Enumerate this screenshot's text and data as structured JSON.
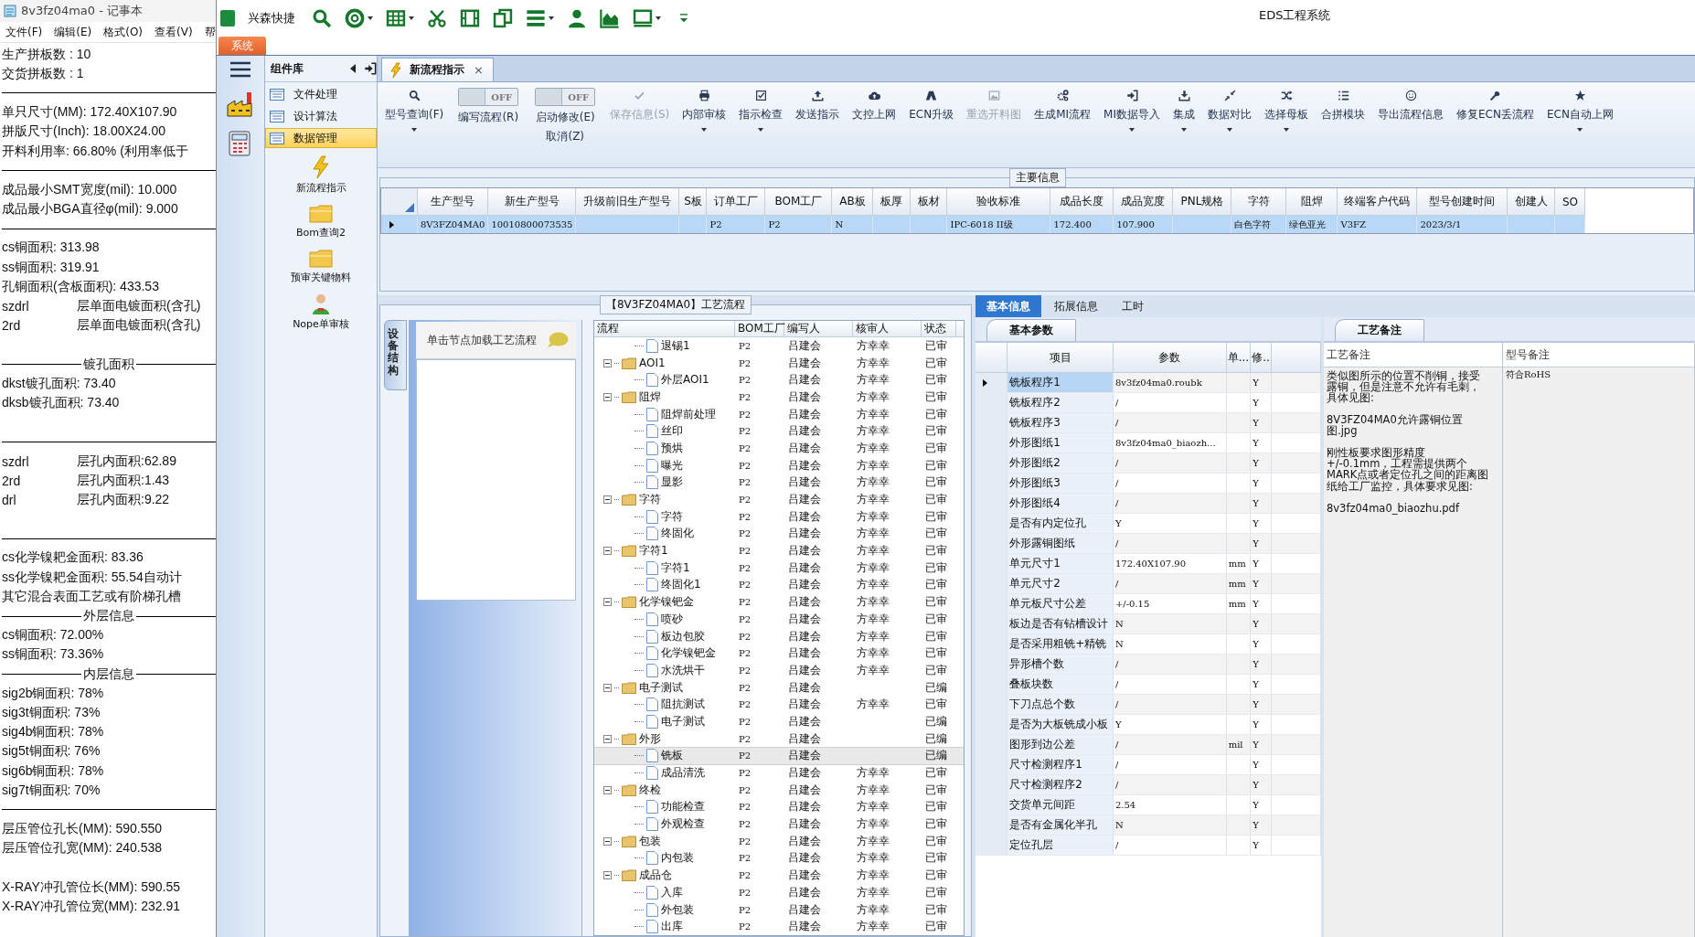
{
  "notepad": {
    "title": "8v3fz04ma0 - 记事本",
    "menu": [
      "文件(F)",
      "编辑(E)",
      "格式(O)",
      "查看(V)",
      "帮"
    ],
    "lines": [
      {
        "kind": "text",
        "text": "生产拼板数 : 10"
      },
      {
        "kind": "text",
        "text": "交货拼板数 : 1"
      },
      {
        "kind": "rule"
      },
      {
        "kind": "text",
        "text": "单只尺寸(MM): 172.40X107.90"
      },
      {
        "kind": "text",
        "text": "拼版尺寸(Inch): 18.00X24.00"
      },
      {
        "kind": "text",
        "text": "开料利用率: 66.80% (利用率低于"
      },
      {
        "kind": "rule"
      },
      {
        "kind": "text",
        "text": "成品最小SMT宽度(mil): 10.000"
      },
      {
        "kind": "text",
        "text": "成品最小BGA直径φ(mil):  9.000"
      },
      {
        "kind": "rule"
      },
      {
        "kind": "text",
        "text": "cs铜面积: 313.98"
      },
      {
        "kind": "text",
        "text": "ss铜面积: 319.91"
      },
      {
        "kind": "text",
        "text": "孔铜面积(含板面积): 433.53"
      },
      {
        "kind": "pair",
        "a": "szdrl",
        "b": "层单面电镀面积(含孔)"
      },
      {
        "kind": "pair",
        "a": "2rd",
        "b": "层单面电镀面积(含孔)"
      },
      {
        "kind": "blank"
      },
      {
        "kind": "heading",
        "text": "镀孔面积"
      },
      {
        "kind": "text",
        "text": "dkst镀孔面积: 73.40"
      },
      {
        "kind": "text",
        "text": "dksb镀孔面积: 73.40"
      },
      {
        "kind": "blank"
      },
      {
        "kind": "rule"
      },
      {
        "kind": "pair",
        "a": "szdrl",
        "b": "层孔内面积:62.89"
      },
      {
        "kind": "pair",
        "a": "2rd",
        "b": "层孔内面积:1.43"
      },
      {
        "kind": "pair",
        "a": "drl",
        "b": "层孔内面积:9.22"
      },
      {
        "kind": "blank"
      },
      {
        "kind": "rule"
      },
      {
        "kind": "text",
        "text": "cs化学镍耙金面积: 83.36"
      },
      {
        "kind": "text",
        "text": "ss化学镍耙金面积: 55.54自动计"
      },
      {
        "kind": "text",
        "text": "其它混合表面工艺或有阶梯孔槽"
      },
      {
        "kind": "heading",
        "text": "外层信息"
      },
      {
        "kind": "text",
        "text": "cs铜面积: 72.00%"
      },
      {
        "kind": "text",
        "text": "ss铜面积: 73.36%"
      },
      {
        "kind": "heading",
        "text": "内层信息"
      },
      {
        "kind": "text",
        "text": "sig2b铜面积: 78%"
      },
      {
        "kind": "text",
        "text": "sig3t铜面积: 73%"
      },
      {
        "kind": "text",
        "text": "sig4b铜面积: 78%"
      },
      {
        "kind": "text",
        "text": "sig5t铜面积: 76%"
      },
      {
        "kind": "text",
        "text": "sig6b铜面积: 78%"
      },
      {
        "kind": "text",
        "text": "sig7t铜面积: 70%"
      },
      {
        "kind": "rule"
      },
      {
        "kind": "text",
        "text": "层压管位孔长(MM): 590.550"
      },
      {
        "kind": "text",
        "text": "层压管位孔宽(MM): 240.538"
      },
      {
        "kind": "blank"
      },
      {
        "kind": "text",
        "text": "X-RAY冲孔管位长(MM): 590.55"
      },
      {
        "kind": "text",
        "text": "X-RAY冲孔管位宽(MM): 232.91"
      }
    ]
  },
  "app": {
    "title": "EDS工程系统",
    "quick_label": "兴森快捷",
    "quick_tools": [
      {
        "dropdown": false
      },
      {
        "dropdown": true
      },
      {
        "dropdown": true
      },
      {
        "dropdown": false
      },
      {
        "dropdown": false
      },
      {
        "dropdown": false
      },
      {
        "dropdown": true
      },
      {
        "dropdown": false
      },
      {
        "dropdown": false
      },
      {
        "dropdown": true
      },
      {
        "dropdown": false
      }
    ],
    "system_tab": "系统"
  },
  "component_panel": {
    "title": "组件库",
    "categories": [
      {
        "label": "文件处理",
        "selected": false
      },
      {
        "label": "设计算法",
        "selected": false
      },
      {
        "label": "数据管理",
        "selected": true
      }
    ],
    "tools": [
      {
        "label": "新流程指示"
      },
      {
        "label": "Bom查询2"
      },
      {
        "label": "预审关键物料"
      },
      {
        "label": "Nope单审核"
      }
    ]
  },
  "doc_tab": {
    "label": "新流程指示",
    "close": "×"
  },
  "ribbon": [
    {
      "kind": "button",
      "label": "型号查询(F)",
      "dropdown": true,
      "disabled": false
    },
    {
      "kind": "toggle",
      "label": "编写流程(R)",
      "state_text": "OFF",
      "on": false
    },
    {
      "kind": "toggle",
      "label": "启动修改(E)",
      "label_2": "取消(Z)",
      "state_text": "OFF",
      "on": false
    },
    {
      "kind": "button",
      "label": "保存信息(S)",
      "dropdown": false,
      "disabled": true
    },
    {
      "kind": "button",
      "label": "内部审核",
      "dropdown": true,
      "disabled": false
    },
    {
      "kind": "button",
      "label": "指示检查",
      "dropdown": true,
      "disabled": false
    },
    {
      "kind": "button",
      "label": "发送指示",
      "dropdown": false,
      "disabled": false
    },
    {
      "kind": "button",
      "label": "文控上网",
      "dropdown": false,
      "disabled": false
    },
    {
      "kind": "button",
      "label": "ECN升级",
      "dropdown": false,
      "disabled": false
    },
    {
      "kind": "button",
      "label": "重选开料图",
      "dropdown": false,
      "disabled": true
    },
    {
      "kind": "button",
      "label": "生成MI流程",
      "dropdown": false,
      "disabled": false
    },
    {
      "kind": "button",
      "label": "MI数据导入",
      "dropdown": true,
      "disabled": false
    },
    {
      "kind": "button",
      "label": "集成",
      "dropdown": true,
      "disabled": false
    },
    {
      "kind": "button",
      "label": "数据对比",
      "dropdown": true,
      "disabled": false
    },
    {
      "kind": "button",
      "label": "选择母板",
      "dropdown": true,
      "disabled": false
    },
    {
      "kind": "button",
      "label": "合拼模块",
      "dropdown": false,
      "disabled": false
    },
    {
      "kind": "button",
      "label": "导出流程信息",
      "dropdown": false,
      "disabled": false
    },
    {
      "kind": "button",
      "label": "修复ECN丢流程",
      "dropdown": false,
      "disabled": false
    },
    {
      "kind": "button",
      "label": "ECN自动上网",
      "dropdown": true,
      "disabled": false
    }
  ],
  "main_info": {
    "title": "主要信息",
    "columns": [
      "生产型号",
      "新生产型号",
      "升级前旧生产型号",
      "S板",
      "订单工厂",
      "BOM工厂",
      "AB板",
      "板厚",
      "板材",
      "验收标准",
      "成品长度",
      "成品宽度",
      "PNL规格",
      "字符",
      "阻焊",
      "终端客户代码",
      "型号创建时间",
      "创建人",
      "SO"
    ],
    "rows": [
      {
        "selected": true,
        "cells": [
          "8V3FZ04MA0",
          "10010800073535",
          null,
          null,
          "P2",
          "P2",
          "N",
          null,
          null,
          "IPC-6018 II级",
          "172.400",
          "107.900",
          null,
          "白色字符",
          "绿色亚光",
          "V3FZ",
          "2023/3/1",
          null,
          null
        ]
      }
    ]
  },
  "process": {
    "title": "【8V3FZ04MA0】工艺流程",
    "side_tab": "设备结构",
    "hint": "单击节点加载工艺流程",
    "columns": [
      "流程",
      "BOM工厂",
      "编写人",
      "核审人",
      "状态"
    ],
    "tree": [
      {
        "kind": "doc",
        "name": "退锡1",
        "bom": "P2",
        "writer": "吕建会",
        "reviewer": "方幸幸",
        "status": "已审",
        "selected": false
      },
      {
        "kind": "folder",
        "name": "AOI1",
        "bom": "P2",
        "writer": "吕建会",
        "reviewer": "方幸幸",
        "status": "已审",
        "selected": false,
        "expanded": true,
        "children": [
          {
            "kind": "doc",
            "name": "外层AOI1",
            "bom": "P2",
            "writer": "吕建会",
            "reviewer": "方幸幸",
            "status": "已审",
            "selected": false
          }
        ]
      },
      {
        "kind": "folder",
        "name": "阻焊",
        "bom": "P2",
        "writer": "吕建会",
        "reviewer": "方幸幸",
        "status": "已审",
        "selected": false,
        "expanded": true,
        "children": [
          {
            "kind": "doc",
            "name": "阻焊前处理",
            "bom": "P2",
            "writer": "吕建会",
            "reviewer": "方幸幸",
            "status": "已审",
            "selected": false
          },
          {
            "kind": "doc",
            "name": "丝印",
            "bom": "P2",
            "writer": "吕建会",
            "reviewer": "方幸幸",
            "status": "已审",
            "selected": false
          },
          {
            "kind": "doc",
            "name": "预烘",
            "bom": "P2",
            "writer": "吕建会",
            "reviewer": "方幸幸",
            "status": "已审",
            "selected": false
          },
          {
            "kind": "doc",
            "name": "曝光",
            "bom": "P2",
            "writer": "吕建会",
            "reviewer": "方幸幸",
            "status": "已审",
            "selected": false
          },
          {
            "kind": "doc",
            "name": "显影",
            "bom": "P2",
            "writer": "吕建会",
            "reviewer": "方幸幸",
            "status": "已审",
            "selected": false
          }
        ]
      },
      {
        "kind": "folder",
        "name": "字符",
        "bom": "P2",
        "writer": "吕建会",
        "reviewer": "方幸幸",
        "status": "已审",
        "selected": false,
        "expanded": true,
        "children": [
          {
            "kind": "doc",
            "name": "字符",
            "bom": "P2",
            "writer": "吕建会",
            "reviewer": "方幸幸",
            "status": "已审",
            "selected": false
          },
          {
            "kind": "doc",
            "name": "终固化",
            "bom": "P2",
            "writer": "吕建会",
            "reviewer": "方幸幸",
            "status": "已审",
            "selected": false
          }
        ]
      },
      {
        "kind": "folder",
        "name": "字符1",
        "bom": "P2",
        "writer": "吕建会",
        "reviewer": "方幸幸",
        "status": "已审",
        "selected": false,
        "expanded": true,
        "children": [
          {
            "kind": "doc",
            "name": "字符1",
            "bom": "P2",
            "writer": "吕建会",
            "reviewer": "方幸幸",
            "status": "已审",
            "selected": false
          },
          {
            "kind": "doc",
            "name": "终固化1",
            "bom": "P2",
            "writer": "吕建会",
            "reviewer": "方幸幸",
            "status": "已审",
            "selected": false
          }
        ]
      },
      {
        "kind": "folder",
        "name": "化学镍钯金",
        "bom": "P2",
        "writer": "吕建会",
        "reviewer": "方幸幸",
        "status": "已审",
        "selected": false,
        "expanded": true,
        "children": [
          {
            "kind": "doc",
            "name": "喷砂",
            "bom": "P2",
            "writer": "吕建会",
            "reviewer": "方幸幸",
            "status": "已审",
            "selected": false
          },
          {
            "kind": "doc",
            "name": "板边包胶",
            "bom": "P2",
            "writer": "吕建会",
            "reviewer": "方幸幸",
            "status": "已审",
            "selected": false
          },
          {
            "kind": "doc",
            "name": "化学镍钯金",
            "bom": "P2",
            "writer": "吕建会",
            "reviewer": "方幸幸",
            "status": "已审",
            "selected": false
          },
          {
            "kind": "doc",
            "name": "水洗烘干",
            "bom": "P2",
            "writer": "吕建会",
            "reviewer": "方幸幸",
            "status": "已审",
            "selected": false
          }
        ]
      },
      {
        "kind": "folder",
        "name": "电子测试",
        "bom": "P2",
        "writer": "吕建会",
        "status": "已编",
        "selected": false,
        "expanded": true,
        "children": [
          {
            "kind": "doc",
            "name": "阻抗测试",
            "bom": "P2",
            "writer": "吕建会",
            "reviewer": "方幸幸",
            "status": "已审",
            "selected": false
          },
          {
            "kind": "doc",
            "name": "电子测试",
            "bom": "P2",
            "writer": "吕建会",
            "status": "已编",
            "selected": false
          }
        ]
      },
      {
        "kind": "folder",
        "name": "外形",
        "bom": "P2",
        "writer": "吕建会",
        "status": "已编",
        "selected": false,
        "expanded": true,
        "children": [
          {
            "kind": "doc",
            "name": "铣板",
            "bom": "P2",
            "writer": "吕建会",
            "status": "已编",
            "selected": true
          },
          {
            "kind": "doc",
            "name": "成品清洗",
            "bom": "P2",
            "writer": "吕建会",
            "reviewer": "方幸幸",
            "status": "已审",
            "selected": false
          }
        ]
      },
      {
        "kind": "folder",
        "name": "终检",
        "bom": "P2",
        "writer": "吕建会",
        "reviewer": "方幸幸",
        "status": "已审",
        "selected": false,
        "expanded": true,
        "children": [
          {
            "kind": "doc",
            "name": "功能检查",
            "bom": "P2",
            "writer": "吕建会",
            "reviewer": "方幸幸",
            "status": "已审",
            "selected": false
          },
          {
            "kind": "doc",
            "name": "外观检查",
            "bom": "P2",
            "writer": "吕建会",
            "reviewer": "方幸幸",
            "status": "已审",
            "selected": false
          }
        ]
      },
      {
        "kind": "folder",
        "name": "包装",
        "bom": "P2",
        "writer": "吕建会",
        "reviewer": "方幸幸",
        "status": "已审",
        "selected": false,
        "expanded": true,
        "children": [
          {
            "kind": "doc",
            "name": "内包装",
            "bom": "P2",
            "writer": "吕建会",
            "reviewer": "方幸幸",
            "status": "已审",
            "selected": false
          }
        ]
      },
      {
        "kind": "folder",
        "name": "成品仓",
        "bom": "P2",
        "writer": "吕建会",
        "reviewer": "方幸幸",
        "status": "已审",
        "selected": false,
        "expanded": true,
        "children": [
          {
            "kind": "doc",
            "name": "入库",
            "bom": "P2",
            "writer": "吕建会",
            "reviewer": "方幸幸",
            "status": "已审",
            "selected": false
          },
          {
            "kind": "doc",
            "name": "外包装",
            "bom": "P2",
            "writer": "吕建会",
            "reviewer": "方幸幸",
            "status": "已审",
            "selected": false
          },
          {
            "kind": "doc",
            "name": "出库",
            "bom": "P2",
            "writer": "吕建会",
            "reviewer": "方幸幸",
            "status": "已审",
            "selected": false
          }
        ]
      }
    ]
  },
  "detail_tabs": [
    {
      "label": "基本信息",
      "selected": true
    },
    {
      "label": "拓展信息",
      "selected": false
    },
    {
      "label": "工时",
      "selected": false
    }
  ],
  "params": {
    "title": "基本参数",
    "columns": [
      "项目",
      "参数",
      "单...",
      "修.."
    ],
    "rows": [
      {
        "item": "铣板程序1",
        "value": "8v3fz04ma0.roubk",
        "flag": "Y",
        "selected": true
      },
      {
        "item": "铣板程序2",
        "value": "/",
        "flag": "Y",
        "selected": false
      },
      {
        "item": "铣板程序3",
        "value": "/",
        "flag": "Y",
        "selected": false
      },
      {
        "item": "外形图纸1",
        "value": "8v3fz04ma0_biaozh...",
        "flag": "Y",
        "selected": false
      },
      {
        "item": "外形图纸2",
        "value": "/",
        "flag": "Y",
        "selected": false
      },
      {
        "item": "外形图纸3",
        "value": "/",
        "flag": "Y",
        "selected": false
      },
      {
        "item": "外形图纸4",
        "value": "/",
        "flag": "Y",
        "selected": false
      },
      {
        "item": "是否有内定位孔",
        "value": "Y",
        "flag": "Y",
        "selected": false
      },
      {
        "item": "外形露铜图纸",
        "value": "/",
        "flag": "Y",
        "selected": false
      },
      {
        "item": "单元尺寸1",
        "value": "172.40X107.90",
        "unit": "mm",
        "flag": "Y",
        "selected": false
      },
      {
        "item": "单元尺寸2",
        "value": "/",
        "unit": "mm",
        "flag": "Y",
        "selected": false
      },
      {
        "item": "单元板尺寸公差",
        "value": "+/-0.15",
        "unit": "mm",
        "flag": "Y",
        "selected": false
      },
      {
        "item": "板边是否有钻槽设计",
        "value": "N",
        "flag": "Y",
        "selected": false
      },
      {
        "item": "是否采用粗铣+精铣",
        "value": "N",
        "flag": "Y",
        "selected": false
      },
      {
        "item": "异形槽个数",
        "value": "/",
        "flag": "Y",
        "selected": false
      },
      {
        "item": "叠板块数",
        "value": "/",
        "flag": "Y",
        "selected": false
      },
      {
        "item": "下刀点总个数",
        "value": "/",
        "flag": "Y",
        "selected": false
      },
      {
        "item": "是否为大板铣成小板",
        "value": "Y",
        "flag": "Y",
        "selected": false
      },
      {
        "item": "图形到边公差",
        "value": "/",
        "unit": "mil",
        "flag": "Y",
        "selected": false
      },
      {
        "item": "尺寸检测程序1",
        "value": "/",
        "flag": "Y",
        "selected": false
      },
      {
        "item": "尺寸检测程序2",
        "value": "/",
        "flag": "Y",
        "selected": false
      },
      {
        "item": "交货单元间距",
        "value": "2.54",
        "flag": "Y",
        "selected": false
      },
      {
        "item": "是否有金属化半孔",
        "value": "N",
        "flag": "Y",
        "selected": false
      },
      {
        "item": "定位孔层",
        "value": "/",
        "flag": "Y",
        "selected": false
      }
    ]
  },
  "notes": {
    "title": "工艺备注",
    "columns": [
      "工艺备注",
      "型号备注"
    ],
    "process_note": [
      "类似图所示的位置不削铜，接受露铜，但是注意不允许有毛刺，具体见图:",
      "8V3FZ04MA0允许露铜位置图.jpg",
      "刚性板要求图形精度+/-0.1mm，工程需提供两个MARK点或者定位孔之间的距离图纸给工厂监控，具体要求见图:",
      "8v3fz04ma0_biaozhu.pdf"
    ],
    "model_note": "符合RoHS"
  }
}
